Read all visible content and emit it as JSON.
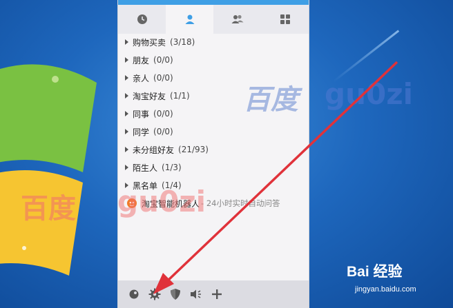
{
  "tabs": [
    {
      "icon": "clock-icon"
    },
    {
      "icon": "contact-icon",
      "active": true
    },
    {
      "icon": "group-icon"
    },
    {
      "icon": "apps-icon"
    }
  ],
  "groups": [
    {
      "name": "购物买卖",
      "count": "(3/18)"
    },
    {
      "name": "朋友",
      "count": "(0/0)"
    },
    {
      "name": "亲人",
      "count": "(0/0)"
    },
    {
      "name": "淘宝好友",
      "count": "(1/1)"
    },
    {
      "name": "同事",
      "count": "(0/0)"
    },
    {
      "name": "同学",
      "count": "(0/0)"
    },
    {
      "name": "未分组好友",
      "count": "(21/93)"
    },
    {
      "name": "陌生人",
      "count": "(1/3)"
    },
    {
      "name": "黑名单",
      "count": "(1/4)"
    }
  ],
  "robot": {
    "name": "淘宝智能机器人",
    "desc": "- 24小时实时自动问答"
  },
  "bottom_icons": [
    "chat-bubble-icon",
    "gear-icon",
    "shield-icon",
    "volume-icon",
    "add-icon"
  ],
  "watermarks": {
    "blue_cn": "百度",
    "blue_en": "gu0zi",
    "red_cn": "百度",
    "red_en": "gu0zi"
  },
  "baidu": {
    "logo": "Bai  经验",
    "url": "jingyan.baidu.com"
  },
  "colors": {
    "accent": "#3f9fe5",
    "arrow": "#e0323a"
  }
}
